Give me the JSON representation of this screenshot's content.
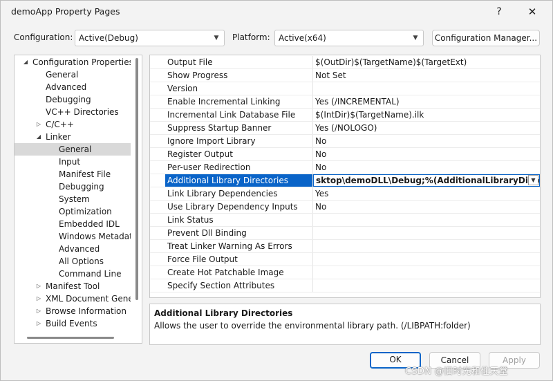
{
  "window": {
    "title": "demoApp Property Pages",
    "help": "?",
    "close": "✕"
  },
  "config": {
    "configuration_label": "Configuration:",
    "configuration_value": "Active(Debug)",
    "platform_label": "Platform:",
    "platform_value": "Active(x64)",
    "manager_button": "Configuration Manager..."
  },
  "tree": {
    "items": [
      {
        "label": "Configuration Properties",
        "expander": "◢"
      },
      {
        "label": "General",
        "expander": ""
      },
      {
        "label": "Advanced",
        "expander": ""
      },
      {
        "label": "Debugging",
        "expander": ""
      },
      {
        "label": "VC++ Directories",
        "expander": ""
      },
      {
        "label": "C/C++",
        "expander": "▷"
      },
      {
        "label": "Linker",
        "expander": "◢"
      },
      {
        "label": "General",
        "expander": ""
      },
      {
        "label": "Input",
        "expander": ""
      },
      {
        "label": "Manifest File",
        "expander": ""
      },
      {
        "label": "Debugging",
        "expander": ""
      },
      {
        "label": "System",
        "expander": ""
      },
      {
        "label": "Optimization",
        "expander": ""
      },
      {
        "label": "Embedded IDL",
        "expander": ""
      },
      {
        "label": "Windows Metadata",
        "expander": ""
      },
      {
        "label": "Advanced",
        "expander": ""
      },
      {
        "label": "All Options",
        "expander": ""
      },
      {
        "label": "Command Line",
        "expander": ""
      },
      {
        "label": "Manifest Tool",
        "expander": "▷"
      },
      {
        "label": "XML Document Genera",
        "expander": "▷"
      },
      {
        "label": "Browse Information",
        "expander": "▷"
      },
      {
        "label": "Build Events",
        "expander": "▷"
      }
    ]
  },
  "properties": {
    "rows": [
      {
        "name": "Output File",
        "value": "$(OutDir)$(TargetName)$(TargetExt)"
      },
      {
        "name": "Show Progress",
        "value": "Not Set"
      },
      {
        "name": "Version",
        "value": ""
      },
      {
        "name": "Enable Incremental Linking",
        "value": "Yes (/INCREMENTAL)"
      },
      {
        "name": "Incremental Link Database File",
        "value": "$(IntDir)$(TargetName).ilk"
      },
      {
        "name": "Suppress Startup Banner",
        "value": "Yes (/NOLOGO)"
      },
      {
        "name": "Ignore Import Library",
        "value": "No"
      },
      {
        "name": "Register Output",
        "value": "No"
      },
      {
        "name": "Per-user Redirection",
        "value": "No"
      },
      {
        "name": "Additional Library Directories",
        "value": "sktop\\demoDLL\\Debug;%(AdditionalLibraryDirectories)"
      },
      {
        "name": "Link Library Dependencies",
        "value": "Yes"
      },
      {
        "name": "Use Library Dependency Inputs",
        "value": "No"
      },
      {
        "name": "Link Status",
        "value": ""
      },
      {
        "name": "Prevent Dll Binding",
        "value": ""
      },
      {
        "name": "Treat Linker Warning As Errors",
        "value": ""
      },
      {
        "name": "Force File Output",
        "value": ""
      },
      {
        "name": "Create Hot Patchable Image",
        "value": ""
      },
      {
        "name": "Specify Section Attributes",
        "value": ""
      }
    ]
  },
  "description": {
    "title": "Additional Library Directories",
    "text": "Allows the user to override the environmental library path. (/LIBPATH:folder)"
  },
  "buttons": {
    "ok": "OK",
    "cancel": "Cancel",
    "apply": "Apply"
  },
  "watermark": "CSDN @旧时光和住天堂"
}
